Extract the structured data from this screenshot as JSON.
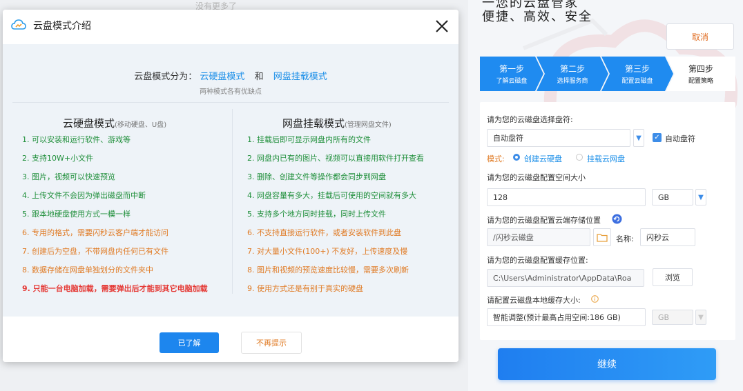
{
  "background": {
    "top_text": "没有更多了"
  },
  "wizard": {
    "slogan_top": "一您的云盘管家",
    "slogan": "便捷、高效、安全",
    "cancel_label": "取消",
    "steps": [
      {
        "title": "第一步",
        "sub": "了解云磁盘",
        "active": true
      },
      {
        "title": "第二步",
        "sub": "选择服务商",
        "active": true
      },
      {
        "title": "第三步",
        "sub": "配置云磁盘",
        "active": true
      },
      {
        "title": "第四步",
        "sub": "配置策略",
        "active": false
      }
    ],
    "drive_label": "请为您的云磁盘选择盘符:",
    "drive_value": "自动盘符",
    "auto_drive_label": "自动盘符",
    "auto_drive_checked": true,
    "mode_label": "模式:",
    "mode_options": [
      {
        "label": "创建云硬盘",
        "selected": true
      },
      {
        "label": "挂载云网盘",
        "selected": false
      }
    ],
    "size_label": "请为您的云磁盘配置空间大小",
    "size_value": "128",
    "size_unit": "GB",
    "location_label": "请为您的云磁盘配置云端存储位置",
    "location_value": "/闪秒云磁盘",
    "name_label": "名称:",
    "name_value": "闪秒云",
    "cache_label": "请为您的云磁盘配置缓存位置:",
    "cache_value": "C:\\Users\\Administrator\\AppData\\Roa",
    "browse_label": "浏览",
    "local_cache_label": "请配置云磁盘本地缓存大小:",
    "local_cache_value": "智能调整(预计最高占用空间:186 GB)",
    "local_cache_unit": "GB",
    "continue_label": "继续",
    "colors": {
      "accent": "#1d86ee",
      "step_active": "#1f8bf0",
      "warning": "#e07b25"
    }
  },
  "modal": {
    "title": "云盘模式介绍",
    "intro_prefix": "云盘模式分为：",
    "intro_mode1": "云硬盘模式",
    "intro_and": "和",
    "intro_mode2": "网盘挂载模式",
    "intro_sub": "两种模式各有优缺点",
    "left": {
      "title": "云硬盘模式",
      "subtitle": "(移动硬盘、U盘)",
      "items": [
        {
          "text": "1. 可以安装和运行软件、游戏等",
          "tone": "green"
        },
        {
          "text": "2. 支持10W+小文件",
          "tone": "green"
        },
        {
          "text": "3. 图片，视频可以快速预览",
          "tone": "green"
        },
        {
          "text": "4. 上传文件不会因为弹出磁盘而中断",
          "tone": "green"
        },
        {
          "text": "5. 跟本地硬盘使用方式一模一样",
          "tone": "green"
        },
        {
          "text": "6. 专用的格式，需要闪秒云客户端才能访问",
          "tone": "orange"
        },
        {
          "text": "7. 创建后为空盘，不带网盘内任何已有文件",
          "tone": "orange"
        },
        {
          "text": "8. 数据存储在网盘单独划分的文件夹中",
          "tone": "orange"
        },
        {
          "text": "9. 只能一台电脑加载，需要弹出后才能到其它电脑加载",
          "tone": "red"
        }
      ]
    },
    "right": {
      "title": "网盘挂载模式",
      "subtitle": "(管理网盘文件)",
      "items": [
        {
          "text": "1. 挂载后即可显示网盘内所有的文件",
          "tone": "green"
        },
        {
          "text": "2. 网盘内已有的图片、视频可以直接用软件打开查看",
          "tone": "green"
        },
        {
          "text": "3. 删除、创建文件等操作都会同步到网盘",
          "tone": "green"
        },
        {
          "text": "4. 网盘容量有多大，挂载后可使用的空间就有多大",
          "tone": "green"
        },
        {
          "text": "5. 支持多个地方同时挂载，同时上传文件",
          "tone": "green"
        },
        {
          "text": "6. 不支持直接运行软件，或者安装软件到此盘",
          "tone": "orange"
        },
        {
          "text": "7. 对大量小文件(100+) 不友好，上传速度及慢",
          "tone": "orange"
        },
        {
          "text": "8. 图片和视频的预览速度比较慢，需要多次刷新",
          "tone": "orange"
        },
        {
          "text": "9. 使用方式还是有别于真实的硬盘",
          "tone": "orange"
        }
      ]
    },
    "ok_label": "已了解",
    "nomore_label": "不再提示",
    "colors": {
      "green": "#1f8f3a",
      "orange": "#e07b25",
      "red": "#e53935",
      "blue": "#1a8ee8"
    }
  }
}
